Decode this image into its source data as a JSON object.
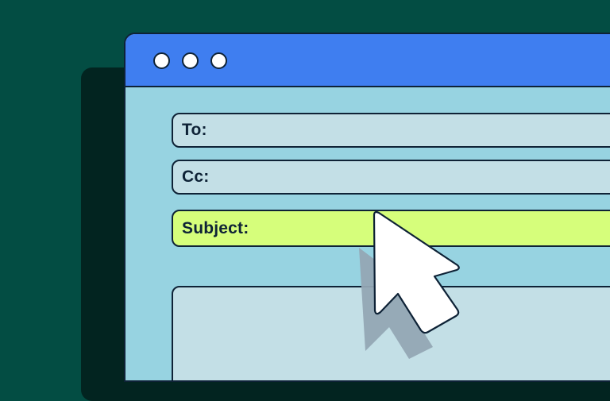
{
  "compose": {
    "to_label": "To:",
    "cc_label": "Cc:",
    "subject_label": "Subject:"
  },
  "window_controls": [
    "window-dot",
    "window-dot",
    "window-dot"
  ],
  "colors": {
    "background": "#034d43",
    "titlebar": "#3f7ef0",
    "window": "#97d3e1",
    "field": "#c3dfe6",
    "subject_highlight": "#d6fe7b",
    "outline": "#0e2236"
  },
  "icons": {
    "pointer": "mouse-pointer-icon"
  }
}
